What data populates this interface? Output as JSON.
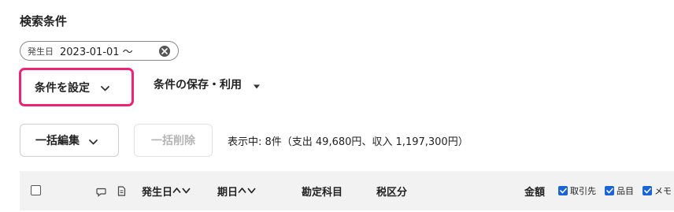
{
  "search": {
    "title": "検索条件",
    "chip": {
      "key": "発生日",
      "value": "2023-01-01 〜"
    }
  },
  "toolbar": {
    "set_conditions_label": "条件を設定",
    "save_use_label": "条件の保存・利用",
    "bulk_edit_label": "一括編集",
    "bulk_delete_label": "一括削除",
    "status_text": "表示中: 8件（支出 49,680円、収入 1,197,300円）"
  },
  "table": {
    "headers": {
      "date": "発生日",
      "due": "期日",
      "account": "勘定科目",
      "tax": "税区分",
      "amount": "金額"
    },
    "options": [
      {
        "label": "取引先",
        "checked": true
      },
      {
        "label": "品目",
        "checked": true
      },
      {
        "label": "メモ",
        "checked": true
      }
    ]
  },
  "colors": {
    "accent_border": "#ee2377",
    "checkbox_blue": "#1a64d6",
    "header_bg": "#f2f2f2"
  }
}
